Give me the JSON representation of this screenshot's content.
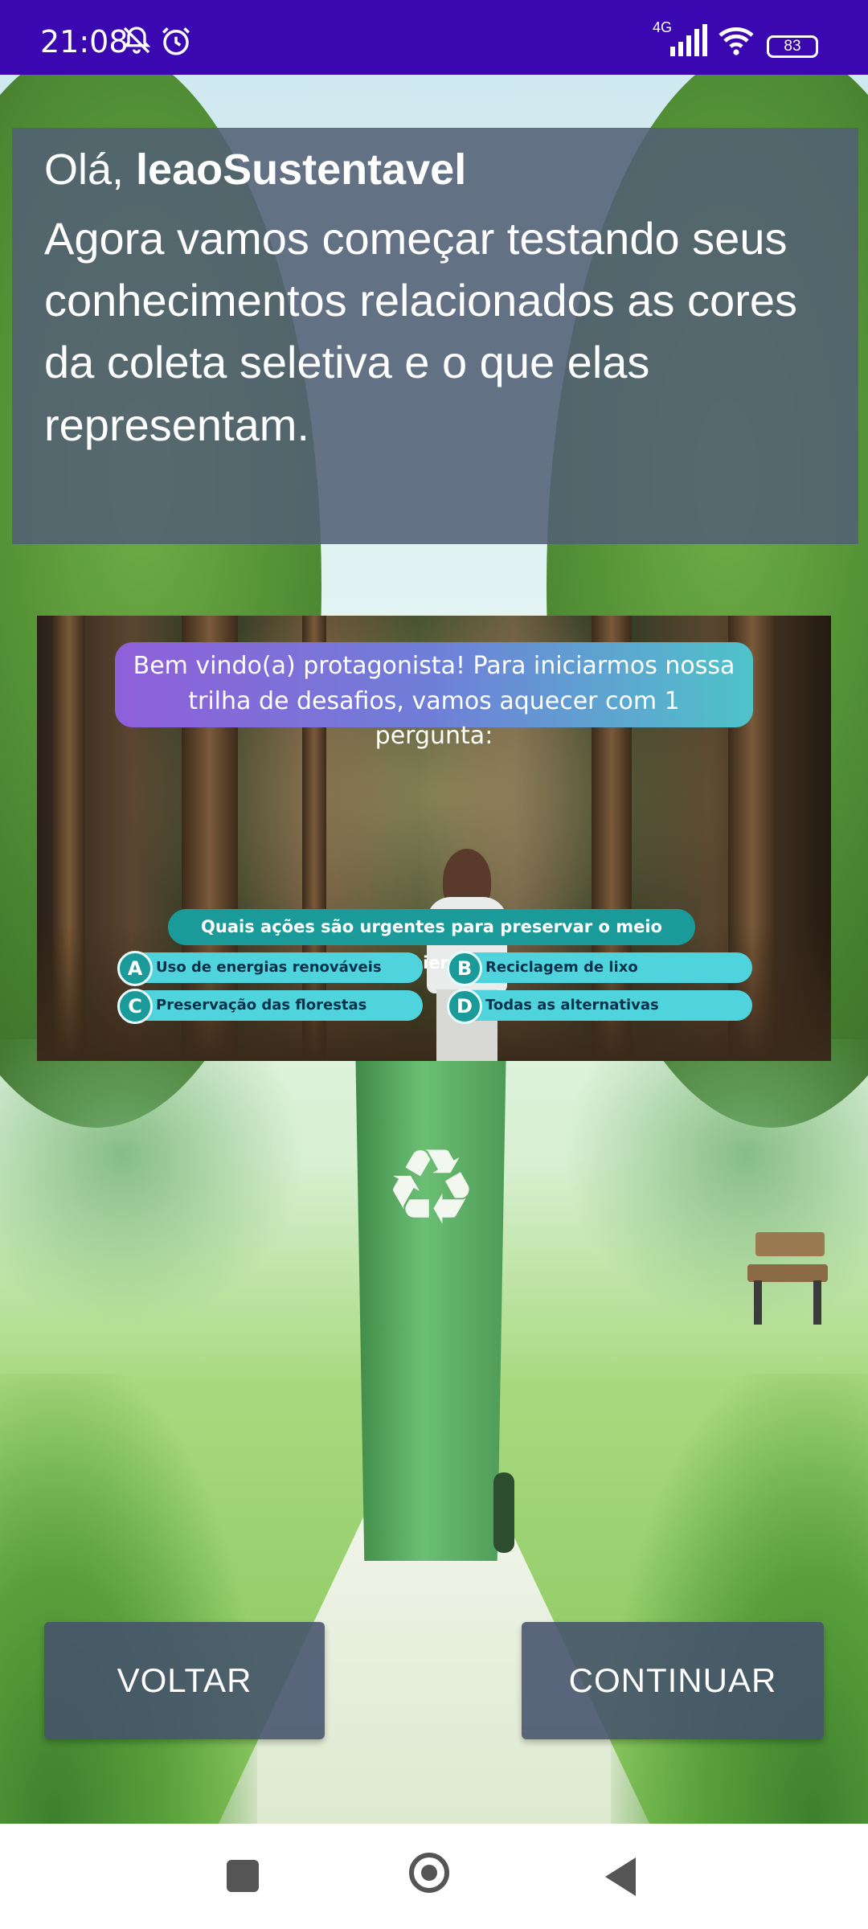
{
  "status_bar": {
    "time": "21:08",
    "network": "4G",
    "battery": "83",
    "icons": [
      "bell-off-icon",
      "alarm-icon",
      "signal-icon",
      "wifi-icon",
      "battery-icon"
    ]
  },
  "greeting": {
    "prefix": "Olá, ",
    "username": "leaoSustentavel",
    "message": "Agora vamos começar testando seus conhecimentos relacionados as cores da coleta seletiva e o que elas representam."
  },
  "quiz_image": {
    "intro": "Bem vindo(a) protagonista! Para iniciarmos nossa trilha de desafios, vamos aquecer com 1 pergunta:",
    "question": "Quais ações são urgentes para preservar o meio ambiente?",
    "options": [
      {
        "letter": "A",
        "text": "Uso de energias renováveis"
      },
      {
        "letter": "B",
        "text": "Reciclagem de lixo"
      },
      {
        "letter": "C",
        "text": "Preservação das florestas"
      },
      {
        "letter": "D",
        "text": "Todas as alternativas"
      }
    ]
  },
  "background": {
    "bin_symbol": "♻"
  },
  "buttons": {
    "back": "VOLTAR",
    "continue": "CONTINUAR"
  },
  "colors": {
    "status_bar": "#3a07b0",
    "panel": "#526074",
    "button": "#44526c",
    "question_pill": "#1b9a9a",
    "option": "#4fd3dc"
  }
}
